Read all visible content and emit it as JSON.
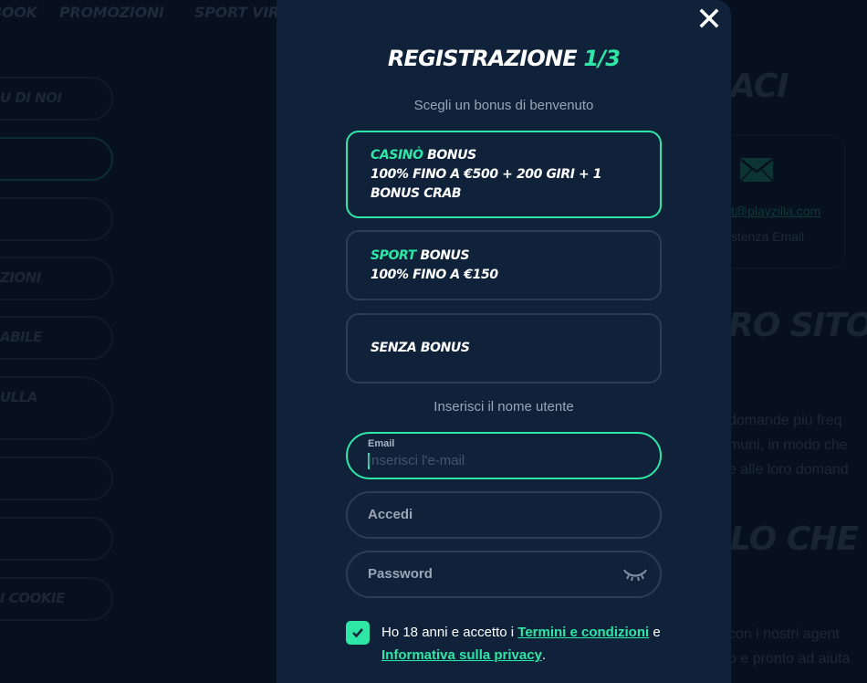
{
  "background": {
    "topnav": [
      "BOOK",
      "PROMOZIONI",
      "SPORT VIR"
    ],
    "sidebar": [
      "U DI NOI",
      "",
      "",
      "ZIONI",
      "ABILE",
      "ULLA",
      "",
      "",
      "I COOKIE"
    ],
    "heading_contact": "ACI",
    "contact_card": {
      "icon": "mail-icon",
      "email_link": "t@playzilla.com",
      "description": "stenza Email"
    },
    "heading_site": "RO SITO V",
    "paragraph1": [
      " domande più freq",
      "muni, in modo che",
      "e alle loro domand"
    ],
    "heading_what": "LO CHE S",
    "paragraph2": [
      " con i nostri agent",
      "o e pronto ad aiuta"
    ]
  },
  "modal": {
    "title": "REGISTRAZIONE",
    "step": "1/3",
    "close_icon": "close-icon",
    "bonus_prompt": "Scegli un bonus di benvenuto",
    "bonuses": [
      {
        "accent": "CASINÒ",
        "title": "BONUS",
        "lines": [
          "100% FINO A €500 + 200 GIRI + 1",
          "BONUS CRAB"
        ],
        "selected": true
      },
      {
        "accent": "SPORT",
        "title": "BONUS",
        "lines": [
          "100% FINO A €150"
        ],
        "selected": false
      },
      {
        "accent": "",
        "title": "SENZA BONUS",
        "lines": [],
        "selected": false
      }
    ],
    "username_prompt": "Inserisci il nome utente",
    "email_field": {
      "label": "Email",
      "placeholder": "Inserisci l'e-mail",
      "value": ""
    },
    "login_field": {
      "placeholder": "Accedi",
      "value": ""
    },
    "password_field": {
      "placeholder": "Password",
      "value": "",
      "toggle_icon": "eye-closed-icon"
    },
    "consent": {
      "checked": true,
      "text_before": "Ho 18 anni e accetto i ",
      "terms_link": "Termini e condizioni",
      "text_middle": " e ",
      "privacy_link": "Informativa sulla privacy",
      "text_after": "."
    }
  },
  "colors": {
    "accent": "#2ee6a5",
    "modal_bg": "#0f2239",
    "page_bg": "#07101e",
    "border": "#2a3d57"
  }
}
